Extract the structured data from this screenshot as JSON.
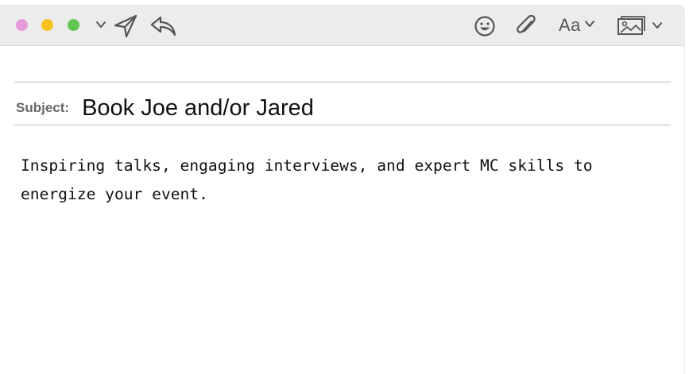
{
  "window": {
    "traffic_lights": {
      "close_color": "#e59ad9",
      "minimize_color": "#f7c21e",
      "maximize_color": "#63c554"
    }
  },
  "toolbar": {
    "icons": [
      "chevron-down-icon",
      "send-icon",
      "reply-icon",
      "emoji-icon",
      "paperclip-icon",
      "chevron-down-icon",
      "photo-icon",
      "chevron-down-icon"
    ],
    "font_button_label": "Aa"
  },
  "compose": {
    "subject_label": "Subject:",
    "subject_value": "Book Joe and/or Jared",
    "body": "Inspiring talks, engaging interviews, and expert MC skills to energize your event."
  }
}
